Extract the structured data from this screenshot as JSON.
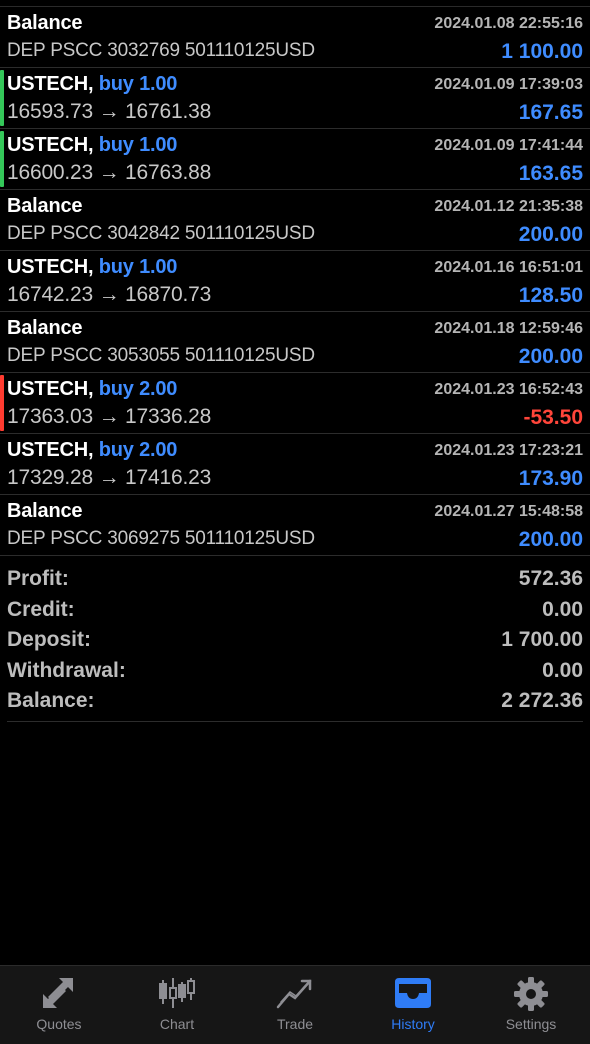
{
  "history": [
    {
      "kind": "balance",
      "title": "Balance",
      "detail": "DEP PSCC 3032769 501110125USD",
      "date": "2024.01.08 22:55:16",
      "amount": "1 100.00",
      "strip": ""
    },
    {
      "kind": "trade",
      "symbol": "USTECH,",
      "side": "buy 1.00",
      "detail": "16593.73 → 16761.38",
      "date": "2024.01.09 17:39:03",
      "amount": "167.65",
      "strip": "#34c759"
    },
    {
      "kind": "trade",
      "symbol": "USTECH,",
      "side": "buy 1.00",
      "detail": "16600.23 → 16763.88",
      "date": "2024.01.09 17:41:44",
      "amount": "163.65",
      "strip": "#34c759"
    },
    {
      "kind": "balance",
      "title": "Balance",
      "detail": "DEP PSCC 3042842 501110125USD",
      "date": "2024.01.12 21:35:38",
      "amount": "200.00",
      "strip": ""
    },
    {
      "kind": "trade",
      "symbol": "USTECH,",
      "side": "buy 1.00",
      "detail": "16742.23 → 16870.73",
      "date": "2024.01.16 16:51:01",
      "amount": "128.50",
      "strip": ""
    },
    {
      "kind": "balance",
      "title": "Balance",
      "detail": "DEP PSCC 3053055 501110125USD",
      "date": "2024.01.18 12:59:46",
      "amount": "200.00",
      "strip": ""
    },
    {
      "kind": "trade",
      "symbol": "USTECH,",
      "side": "buy 2.00",
      "detail": "17363.03 → 17336.28",
      "date": "2024.01.23 16:52:43",
      "amount": "-53.50",
      "strip": "#ff3b30",
      "negative": true
    },
    {
      "kind": "trade",
      "symbol": "USTECH,",
      "side": "buy 2.00",
      "detail": "17329.28 → 17416.23",
      "date": "2024.01.23 17:23:21",
      "amount": "173.90",
      "strip": ""
    },
    {
      "kind": "balance",
      "title": "Balance",
      "detail": "DEP PSCC 3069275 501110125USD",
      "date": "2024.01.27 15:48:58",
      "amount": "200.00",
      "strip": ""
    }
  ],
  "summary": [
    {
      "label": "Profit:",
      "value": "572.36"
    },
    {
      "label": "Credit:",
      "value": "0.00"
    },
    {
      "label": "Deposit:",
      "value": "1 700.00"
    },
    {
      "label": "Withdrawal:",
      "value": "0.00"
    },
    {
      "label": "Balance:",
      "value": "2 272.36"
    }
  ],
  "tabs": [
    {
      "label": "Quotes",
      "icon": "quotes-icon",
      "active": false
    },
    {
      "label": "Chart",
      "icon": "chart-icon",
      "active": false
    },
    {
      "label": "Trade",
      "icon": "trade-icon",
      "active": false
    },
    {
      "label": "History",
      "icon": "history-icon",
      "active": true
    },
    {
      "label": "Settings",
      "icon": "settings-icon",
      "active": false
    }
  ],
  "colors": {
    "accent": "#2f7cf6",
    "profit_blue": "#3f8cff",
    "loss_red": "#ff453a",
    "buy_strip_green": "#34c759",
    "sell_strip_red": "#ff3b30"
  }
}
